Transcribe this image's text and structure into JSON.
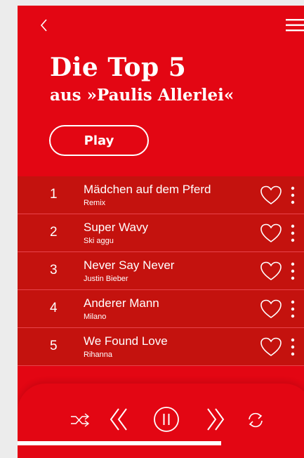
{
  "colors": {
    "brand_red": "#e30613",
    "row_bg": "#c4120e",
    "text": "#ffffff"
  },
  "header": {
    "back_icon": "chevron-left-icon",
    "menu_icon": "hamburger-menu-icon"
  },
  "hero": {
    "title": "Die Top 5",
    "subtitle": "aus »Paulis Allerlei«",
    "play_label": "Play"
  },
  "tracks": [
    {
      "number": "1",
      "title": "Mädchen auf dem Pferd",
      "artist": "Remix"
    },
    {
      "number": "2",
      "title": "Super Wavy",
      "artist": "Ski aggu"
    },
    {
      "number": "3",
      "title": "Never Say Never",
      "artist": "Justin Bieber"
    },
    {
      "number": "4",
      "title": "Anderer Mann",
      "artist": "Milano"
    },
    {
      "number": "5",
      "title": "We Found Love",
      "artist": "Rihanna"
    }
  ],
  "player": {
    "controls": [
      "shuffle-icon",
      "previous-icon",
      "pause-icon",
      "next-icon",
      "repeat-icon"
    ],
    "progress": 0.71
  }
}
